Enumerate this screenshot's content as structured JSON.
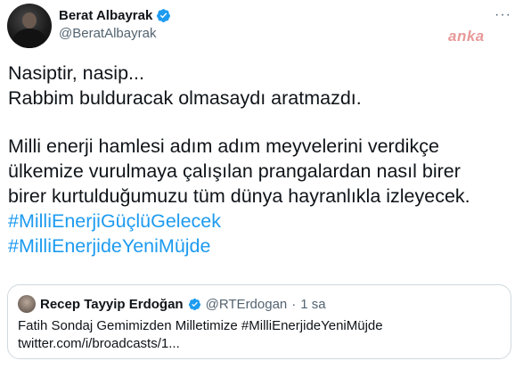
{
  "author": {
    "name": "Berat Albayrak",
    "handle": "@BeratAlbayrak"
  },
  "menu_icon": "more-horizontal-icon",
  "watermark": "anka",
  "tweet": {
    "lines_1": [
      "Nasiptir, nasip...",
      "Rabbim bulduracak olmasaydı aratmazdı."
    ],
    "lines_2": [
      "Milli enerji hamlesi adım adım meyvelerini verdikçe",
      "ülkemize vurulmaya çalışılan prangalardan nasıl birer",
      "birer kurtulduğumuzu tüm dünya hayranlıkla izleyecek."
    ],
    "hashtags": [
      "#MilliEnerjiGüçlüGelecek",
      "#MilliEnerjideYeniMüjde"
    ]
  },
  "quote": {
    "name": "Recep Tayyip Erdoğan",
    "handle": "@RTErdogan",
    "separator": "·",
    "time": "1 sa",
    "text_line_1": "Fatih Sondaj Gemimizden Milletimize #MilliEnerjideYeniMüjde",
    "text_line_2": "twitter.com/i/broadcasts/1..."
  },
  "colors": {
    "link": "#1d9bf0",
    "verified": "#1d9bf0",
    "secondary_text": "#536471",
    "border": "#cfd9de"
  }
}
